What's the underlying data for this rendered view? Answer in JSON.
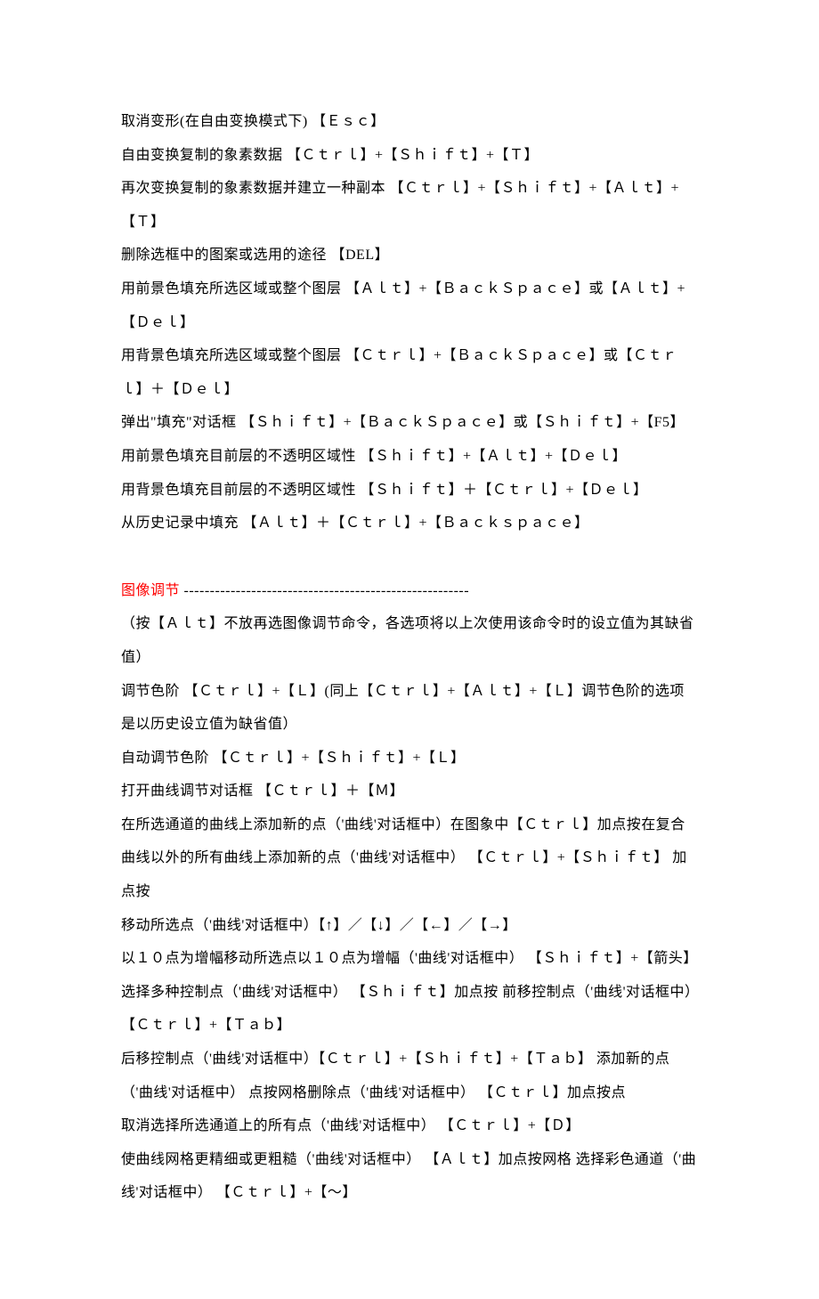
{
  "section1": {
    "lines": [
      "取消变形(在自由变换模式下) 【Ｅｓｃ】",
      "自由变换复制的象素数据 【Ｃｔｒｌ】+【Ｓｈｉｆｔ】+【Ｔ】",
      "再次变换复制的象素数据并建立一种副本  【Ｃｔｒｌ】+【Ｓｈｉｆｔ】+【Ａｌｔ】+【Ｔ】",
      "删除选框中的图案或选用的途径 【DEL】",
      "用前景色填充所选区域或整个图层 【Ａｌｔ】+【ＢａｃｋＳｐａｃｅ】或【Ａｌｔ】+【Ｄｅｌ】",
      "用背景色填充所选区域或整个图层 【Ｃｔｒｌ】+【ＢａｃｋＳｐａｃｅ】或【Ｃｔｒｌ】＋【Ｄｅｌ】",
      "弹出\"填充\"对话框 【Ｓｈｉｆｔ】+【ＢａｃｋＳｐａｃｅ】或【Ｓｈｉｆｔ】+【F5】",
      "用前景色填充目前层的不透明区域性  【Ｓｈｉｆｔ】+【Ａｌｔ】+【Ｄｅｌ】",
      "用背景色填充目前层的不透明区域性 【Ｓｈｉｆｔ】＋【Ｃｔｒｌ】+【Ｄｅｌ】",
      "从历史记录中填充 【Ａｌｔ】＋【Ｃｔｒｌ】+【Ｂａｃｋｓｐａｃｅ】"
    ]
  },
  "section2": {
    "heading_label": "图像调节  ",
    "heading_dashes": "-------------------------------------------------------",
    "lines": [
      "（按【Ａｌｔ】不放再选图像调节命令，各选项将以上次使用该命令时的设立值为其缺省值）",
      "调节色阶 【Ｃｔｒｌ】+【Ｌ】(同上【Ｃｔｒｌ】+【Ａｌｔ】+【Ｌ】调节色阶的选项是以历史设立值为缺省值）",
      "自动调节色阶 【Ｃｔｒｌ】+【Ｓｈｉｆｔ】+【Ｌ】",
      "打开曲线调节对话框 【Ｃｔｒｌ】＋【Ｍ】",
      "在所选通道的曲线上添加新的点（'曲线'对话框中）在图象中【Ｃｔｒｌ】加点按在复合曲线以外的所有曲线上添加新的点（'曲线'对话框中） 【Ｃｔｒｌ】+【Ｓｈｉｆｔ】 加点按",
      "移动所选点（'曲线'对话框中）【↑】／【↓】／【←】／【→】",
      "以１０点为增幅移动所选点以１０点为增幅（'曲线'对话框中） 【Ｓｈｉｆｔ】+【箭头】",
      "选择多种控制点（'曲线'对话框中） 【Ｓｈｉｆｔ】加点按 前移控制点（'曲线'对话框中）【Ｃｔｒｌ】+【Ｔａｂ】",
      "后移控制点（'曲线'对话框中）【Ｃｔｒｌ】+【Ｓｈｉｆｔ】+【Ｔａｂ】 添加新的点（'曲线'对话框中） 点按网格删除点（'曲线'对话框中） 【Ｃｔｒｌ】加点按点",
      "取消选择所选通道上的所有点（'曲线'对话框中） 【Ｃｔｒｌ】+【Ｄ】",
      "使曲线网格更精细或更粗糙（'曲线'对话框中） 【Ａｌｔ】加点按网格 选择彩色通道（'曲线'对话框中） 【Ｃｔｒｌ】+【～】"
    ]
  }
}
